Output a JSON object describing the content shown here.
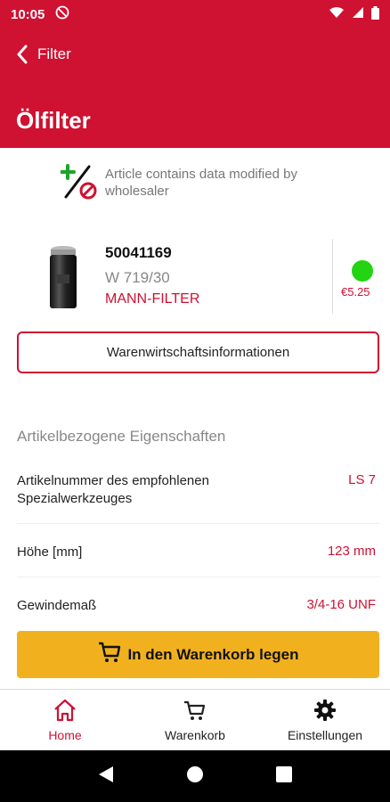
{
  "status_bar": {
    "time": "10:05"
  },
  "header": {
    "back_label": "Filter",
    "title": "Ölfilter"
  },
  "notice": {
    "text": "Article contains data modified by wholesaler"
  },
  "article": {
    "number": "50041169",
    "code": "W 719/30",
    "brand": "MANN-FILTER",
    "price": "€5.25",
    "availability_color": "#22d411"
  },
  "buttons": {
    "warenwirtschaft": "Warenwirtschaftsinformationen",
    "add_to_cart": "In den Warenkorb legen"
  },
  "properties": {
    "title": "Artikelbezogene Eigenschaften",
    "rows": [
      {
        "label": "Artikelnummer des empfohlenen Spezialwerkzeuges",
        "value": "LS 7"
      },
      {
        "label": "Höhe [mm]",
        "value": "123 mm"
      },
      {
        "label": "Gewindemaß",
        "value": "3/4-16 UNF"
      }
    ]
  },
  "bottom_nav": {
    "items": [
      {
        "label": "Home",
        "icon": "home-icon"
      },
      {
        "label": "Warenkorb",
        "icon": "cart-icon"
      },
      {
        "label": "Einstellungen",
        "icon": "gear-icon"
      }
    ]
  },
  "colors": {
    "brand": "#cf1132",
    "accent": "#f1b11f"
  }
}
